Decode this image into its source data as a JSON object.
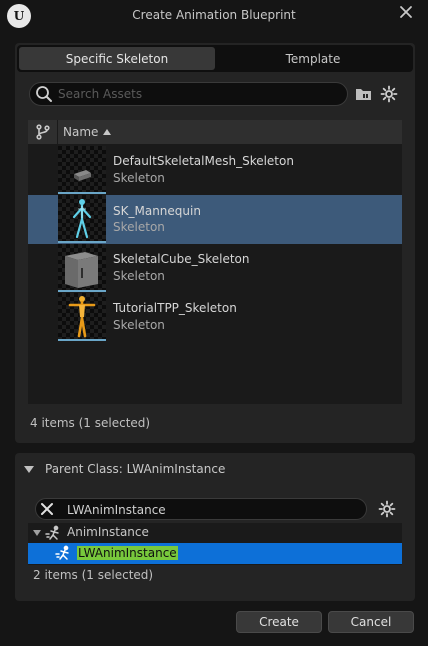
{
  "window": {
    "title": "Create Animation Blueprint"
  },
  "tabs": [
    {
      "label": "Specific Skeleton",
      "active": true
    },
    {
      "label": "Template",
      "active": false
    }
  ],
  "search": {
    "placeholder": "Search Assets",
    "value": ""
  },
  "list": {
    "column_header": "Name",
    "sort": "ascending",
    "items": [
      {
        "name": "DefaultSkeletalMesh_Skeleton",
        "type": "Skeleton",
        "selected": false,
        "thumbnail": "small-grey-cube"
      },
      {
        "name": "SK_Mannequin",
        "type": "Skeleton",
        "selected": true,
        "thumbnail": "blue-mannequin"
      },
      {
        "name": "SkeletalCube_Skeleton",
        "type": "Skeleton",
        "selected": false,
        "thumbnail": "grey-cube"
      },
      {
        "name": "TutorialTPP_Skeleton",
        "type": "Skeleton",
        "selected": false,
        "thumbnail": "orange-mannequin"
      }
    ],
    "status": "4 items (1 selected)"
  },
  "parent_class": {
    "label": "Parent Class: LWAnimInstance",
    "filter_value": "LWAnimInstance",
    "tree": {
      "parent": {
        "label": "AnimInstance",
        "icon": "anim-class-icon"
      },
      "child": {
        "label": "LWAnimInstance",
        "icon": "anim-class-icon",
        "selected": true
      }
    },
    "status": "2 items (1 selected)"
  },
  "buttons": {
    "create": "Create",
    "cancel": "Cancel"
  },
  "colors": {
    "selection_blue": "#0d70d8",
    "row_selected": "#3d5a7a",
    "highlight_green": "#78c83c",
    "thumbnail_underline": "#6aa6c8"
  }
}
